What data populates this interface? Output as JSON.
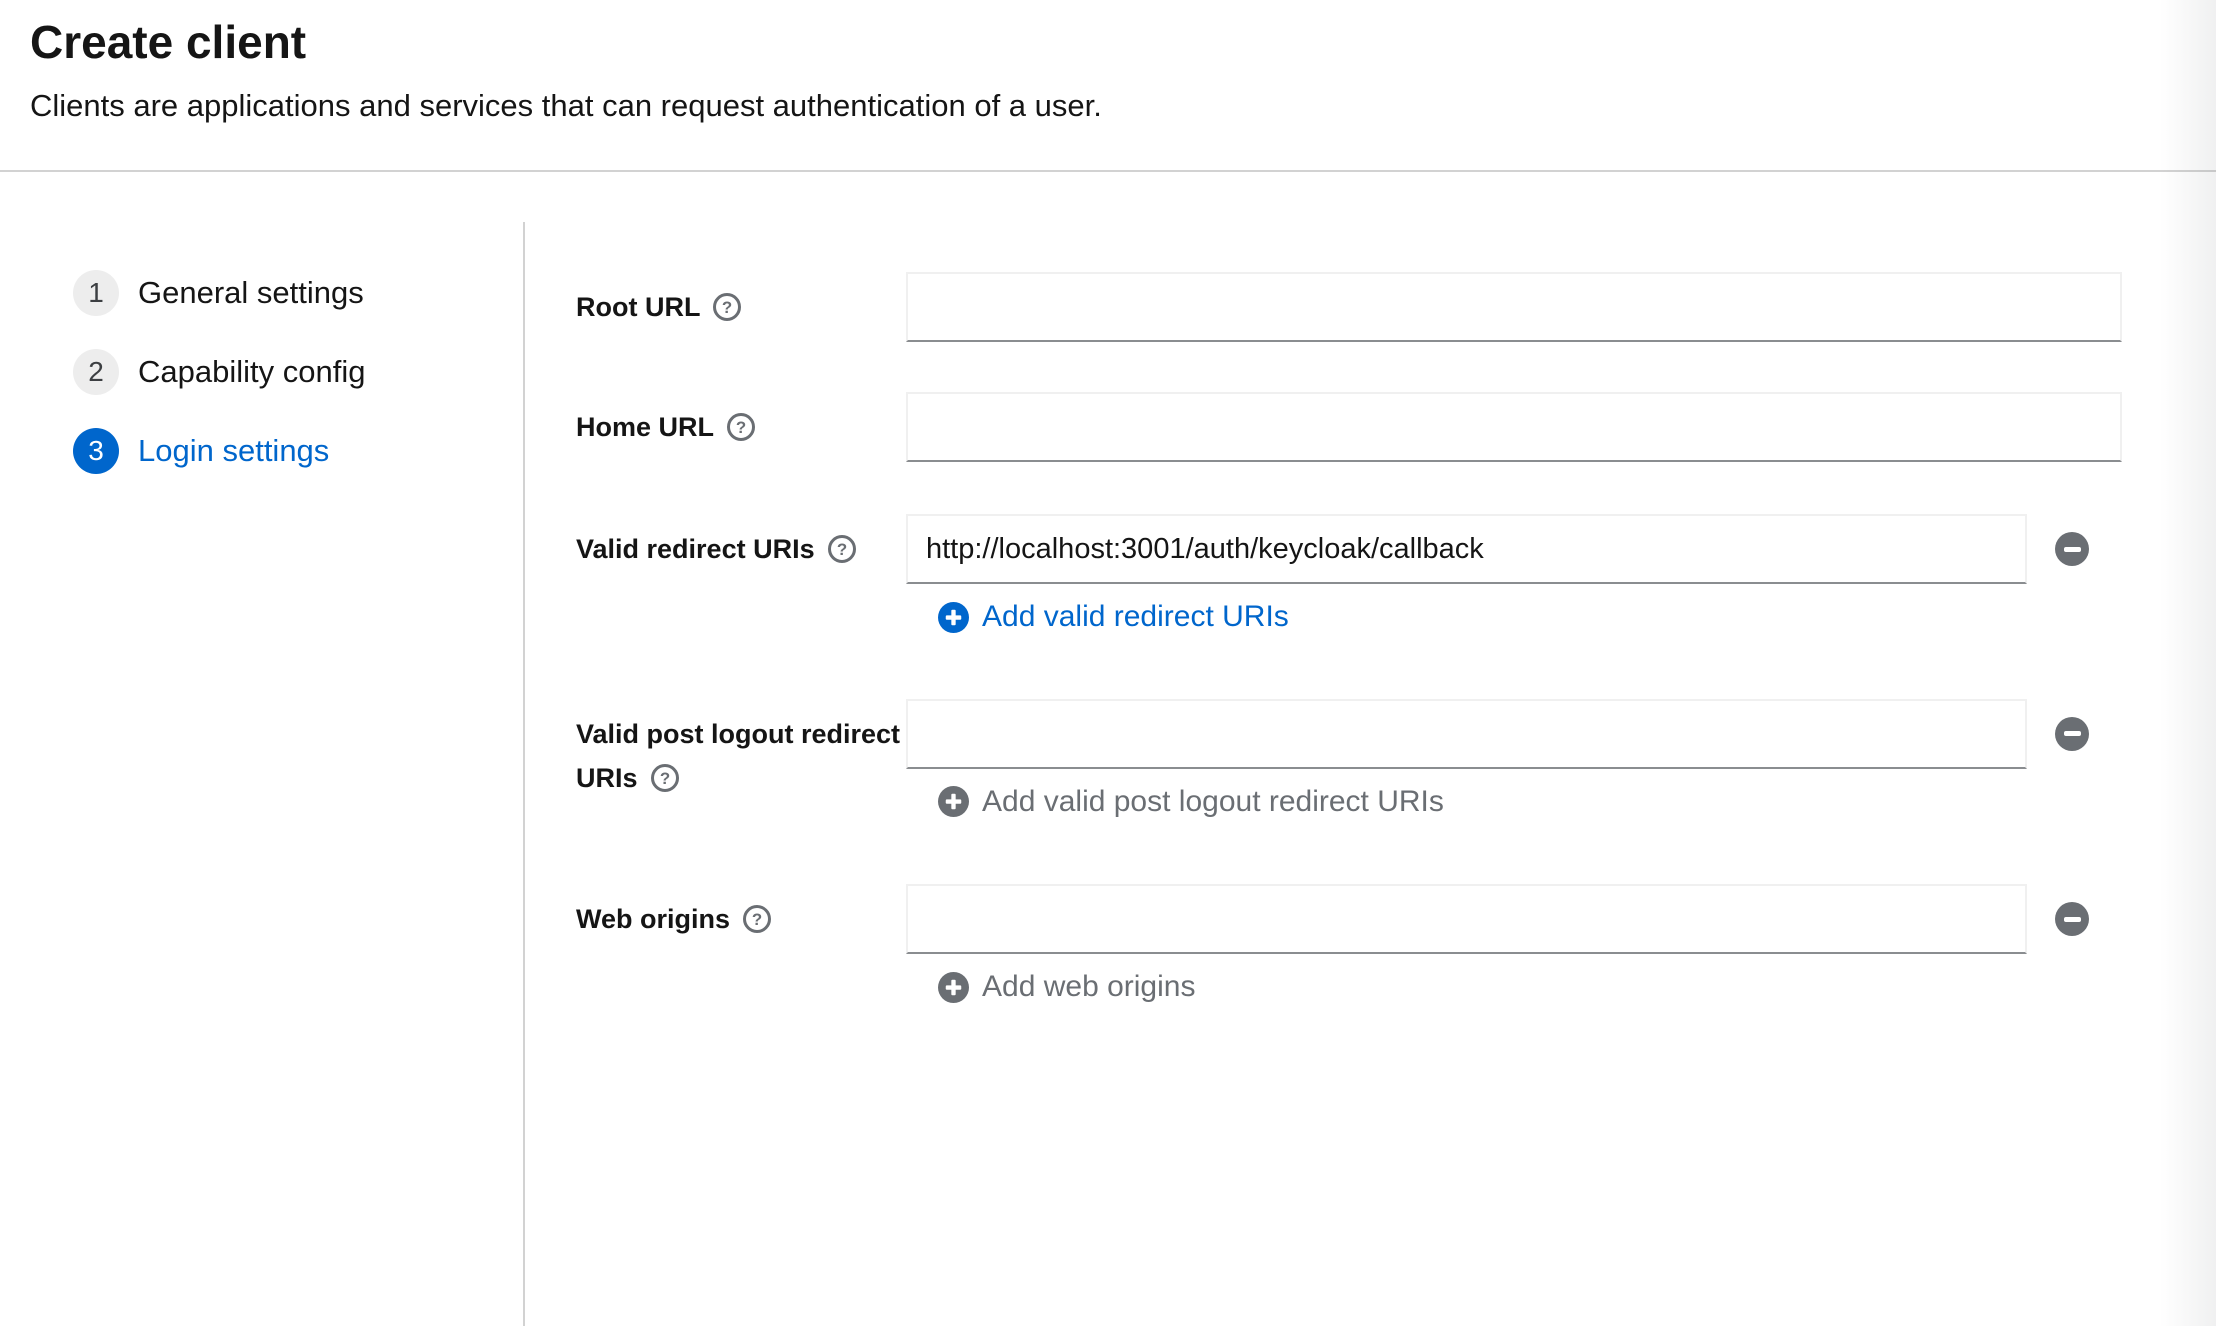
{
  "page": {
    "title": "Create client",
    "subtitle": "Clients are applications and services that can request authentication of a user."
  },
  "wizard": {
    "steps": [
      {
        "number": "1",
        "label": "General settings",
        "active": false
      },
      {
        "number": "2",
        "label": "Capability config",
        "active": false
      },
      {
        "number": "3",
        "label": "Login settings",
        "active": true
      }
    ]
  },
  "form": {
    "fields": [
      {
        "label": "Root URL",
        "value": "",
        "has_help": true
      },
      {
        "label": "Home URL",
        "value": "",
        "has_help": true
      },
      {
        "label": "Valid redirect URIs",
        "value": "http://localhost:3001/auth/keycloak/callback",
        "has_help": true,
        "add_label": "Add valid redirect URIs",
        "add_enabled": true
      },
      {
        "label": "Valid post logout redirect URIs",
        "value": "",
        "has_help": true,
        "add_label": "Add valid post logout redirect URIs",
        "add_enabled": false
      },
      {
        "label": "Web origins",
        "value": "",
        "has_help": true,
        "add_label": "Add web origins",
        "add_enabled": false
      }
    ]
  },
  "icons": {
    "help_glyph": "?",
    "add": "plus-circle",
    "remove": "minus-circle"
  },
  "colors": {
    "accent_blue": "#0066cc",
    "text": "#151515",
    "muted_gray": "#6a6e73",
    "divider": "#d2d2d2",
    "input_bottom_border": "#8a8d90",
    "step_inactive_bg": "#ededed"
  }
}
